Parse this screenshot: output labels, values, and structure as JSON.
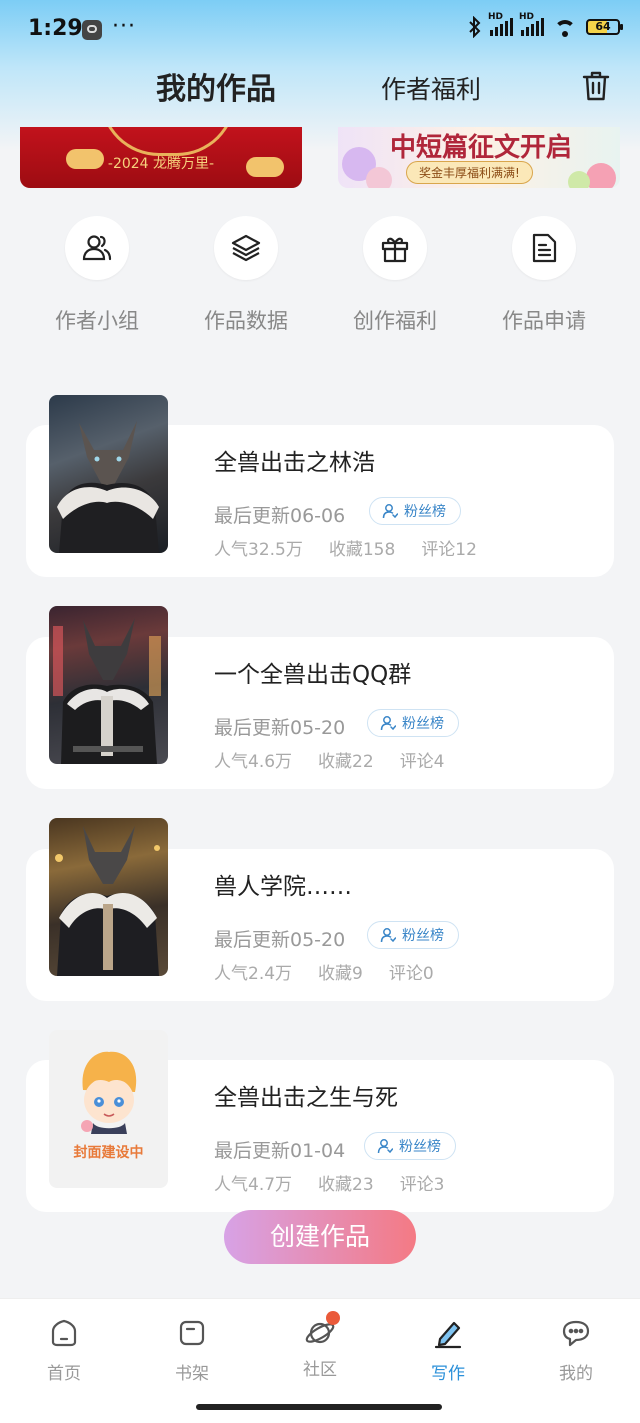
{
  "status": {
    "time": "1:29",
    "dots": "···",
    "hd": "HD",
    "battery": "64"
  },
  "header": {
    "tab_active": "我的作品",
    "tab_other": "作者福利"
  },
  "banners": {
    "left_text": "-2024 龙腾万里-",
    "right_title": "中短篇征文开启",
    "right_sub": "奖金丰厚福利满满!"
  },
  "quick_actions": [
    {
      "label": "作者小组",
      "icon": "people-icon"
    },
    {
      "label": "作品数据",
      "icon": "layers-icon"
    },
    {
      "label": "创作福利",
      "icon": "gift-icon"
    },
    {
      "label": "作品申请",
      "icon": "document-icon"
    }
  ],
  "works": [
    {
      "title": "全兽出击之林浩",
      "updated": "最后更新06-06",
      "fans": "粉丝榜",
      "popularity": "人气32.5万",
      "favorites": "收藏158",
      "comments": "评论12"
    },
    {
      "title": "一个全兽出击QQ群",
      "updated": "最后更新05-20",
      "fans": "粉丝榜",
      "popularity": "人气4.6万",
      "favorites": "收藏22",
      "comments": "评论4"
    },
    {
      "title": "兽人学院……",
      "updated": "最后更新05-20",
      "fans": "粉丝榜",
      "popularity": "人气2.4万",
      "favorites": "收藏9",
      "comments": "评论0"
    },
    {
      "title": "全兽出击之生与死",
      "updated": "最后更新01-04",
      "fans": "粉丝榜",
      "popularity": "人气4.7万",
      "favorites": "收藏23",
      "comments": "评论3",
      "cover_text": "封面建设中"
    }
  ],
  "create_button": "创建作品",
  "nav": [
    {
      "label": "首页",
      "icon": "home-icon"
    },
    {
      "label": "书架",
      "icon": "bookshelf-icon"
    },
    {
      "label": "社区",
      "icon": "planet-icon"
    },
    {
      "label": "写作",
      "icon": "pen-icon"
    },
    {
      "label": "我的",
      "icon": "chat-icon"
    }
  ],
  "colors": {
    "accent": "#2b90d9",
    "fab_start": "#d7a2e6",
    "fab_end": "#f47a84",
    "background": "#f3f4f6"
  }
}
